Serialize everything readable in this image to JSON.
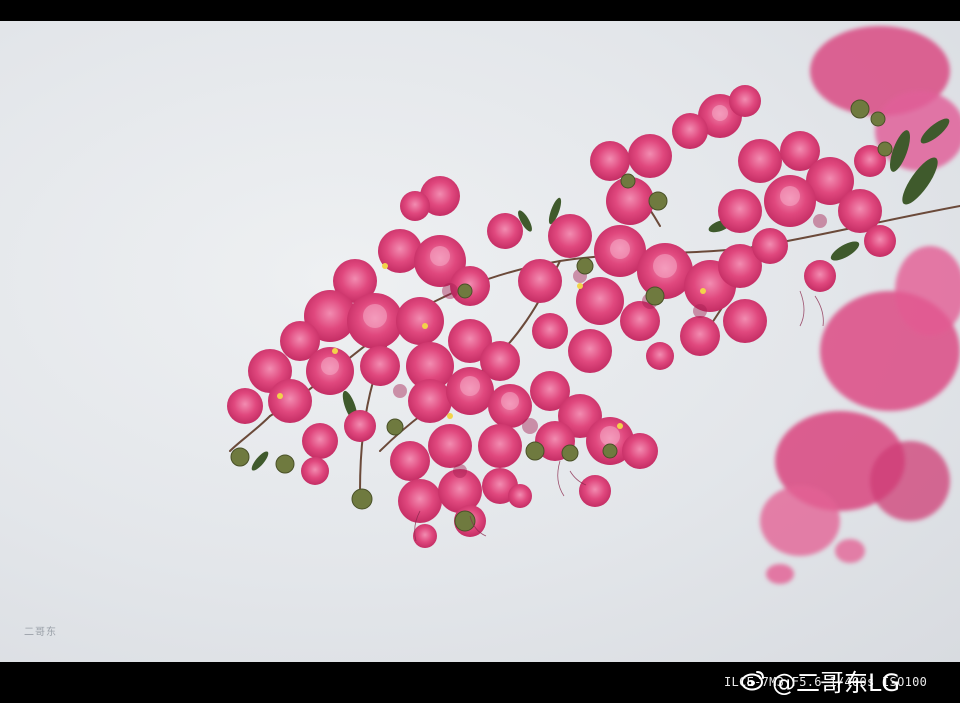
{
  "photo": {
    "subject": "crape-myrtle-blossoms",
    "signature_text": "二哥东",
    "colors": {
      "sky": "#e4e7eb",
      "blossom_pink": "#e0487e",
      "blossom_light": "#ef7aa5",
      "blossom_deep": "#b8245a",
      "leaf_green": "#3f5a2c",
      "stem": "#6b4a3a"
    }
  },
  "footer": {
    "exif_text": "ILCE-7M3 F5.6 1/400s ISO100",
    "watermark_text": "@二哥东LG",
    "watermark_icon": "weibo-logo-icon"
  }
}
